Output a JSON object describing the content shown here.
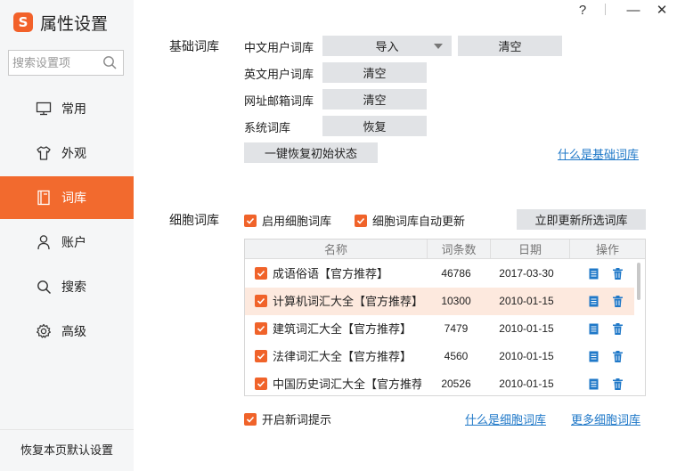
{
  "app": {
    "logo_char": "S",
    "title": "属性设置"
  },
  "window": {
    "help": "?",
    "minimize": "—",
    "close": "✕"
  },
  "search": {
    "placeholder": "搜索设置项"
  },
  "nav": [
    {
      "label": "常用",
      "icon": "monitor-icon"
    },
    {
      "label": "外观",
      "icon": "shirt-icon"
    },
    {
      "label": "词库",
      "icon": "book-icon",
      "active": true
    },
    {
      "label": "账户",
      "icon": "user-icon"
    },
    {
      "label": "搜索",
      "icon": "search-icon"
    },
    {
      "label": "高级",
      "icon": "gear-icon"
    }
  ],
  "restore_defaults": "恢复本页默认设置",
  "basic": {
    "title": "基础词库",
    "rows": [
      {
        "label": "中文用户词库",
        "import": "导入",
        "clear": "清空"
      },
      {
        "label": "英文用户词库",
        "clear": "清空"
      },
      {
        "label": "网址邮箱词库",
        "clear": "清空"
      },
      {
        "label": "系统词库",
        "restore": "恢复"
      }
    ],
    "restore_all": "一键恢复初始状态",
    "help_link": "什么是基础词库"
  },
  "cell": {
    "title": "细胞词库",
    "enable": "启用细胞词库",
    "auto_update": "细胞词库自动更新",
    "update_now": "立即更新所选词库",
    "columns": [
      "名称",
      "词条数",
      "日期",
      "操作"
    ],
    "rows": [
      {
        "name": "成语俗语【官方推荐】",
        "count": "46786",
        "date": "2017-03-30"
      },
      {
        "name": "计算机词汇大全【官方推荐】",
        "count": "10300",
        "date": "2010-01-15"
      },
      {
        "name": "建筑词汇大全【官方推荐】",
        "count": "7479",
        "date": "2010-01-15"
      },
      {
        "name": "法律词汇大全【官方推荐】",
        "count": "4560",
        "date": "2010-01-15"
      },
      {
        "name": "中国历史词汇大全【官方推荐】",
        "count": "20526",
        "date": "2010-01-15"
      }
    ],
    "new_word_tip": "开启新词提示",
    "what_link": "什么是细胞词库",
    "more_link": "更多细胞词库"
  },
  "colors": {
    "accent": "#f26a2e",
    "link": "#1f78c8",
    "button": "#e1e3e6"
  }
}
